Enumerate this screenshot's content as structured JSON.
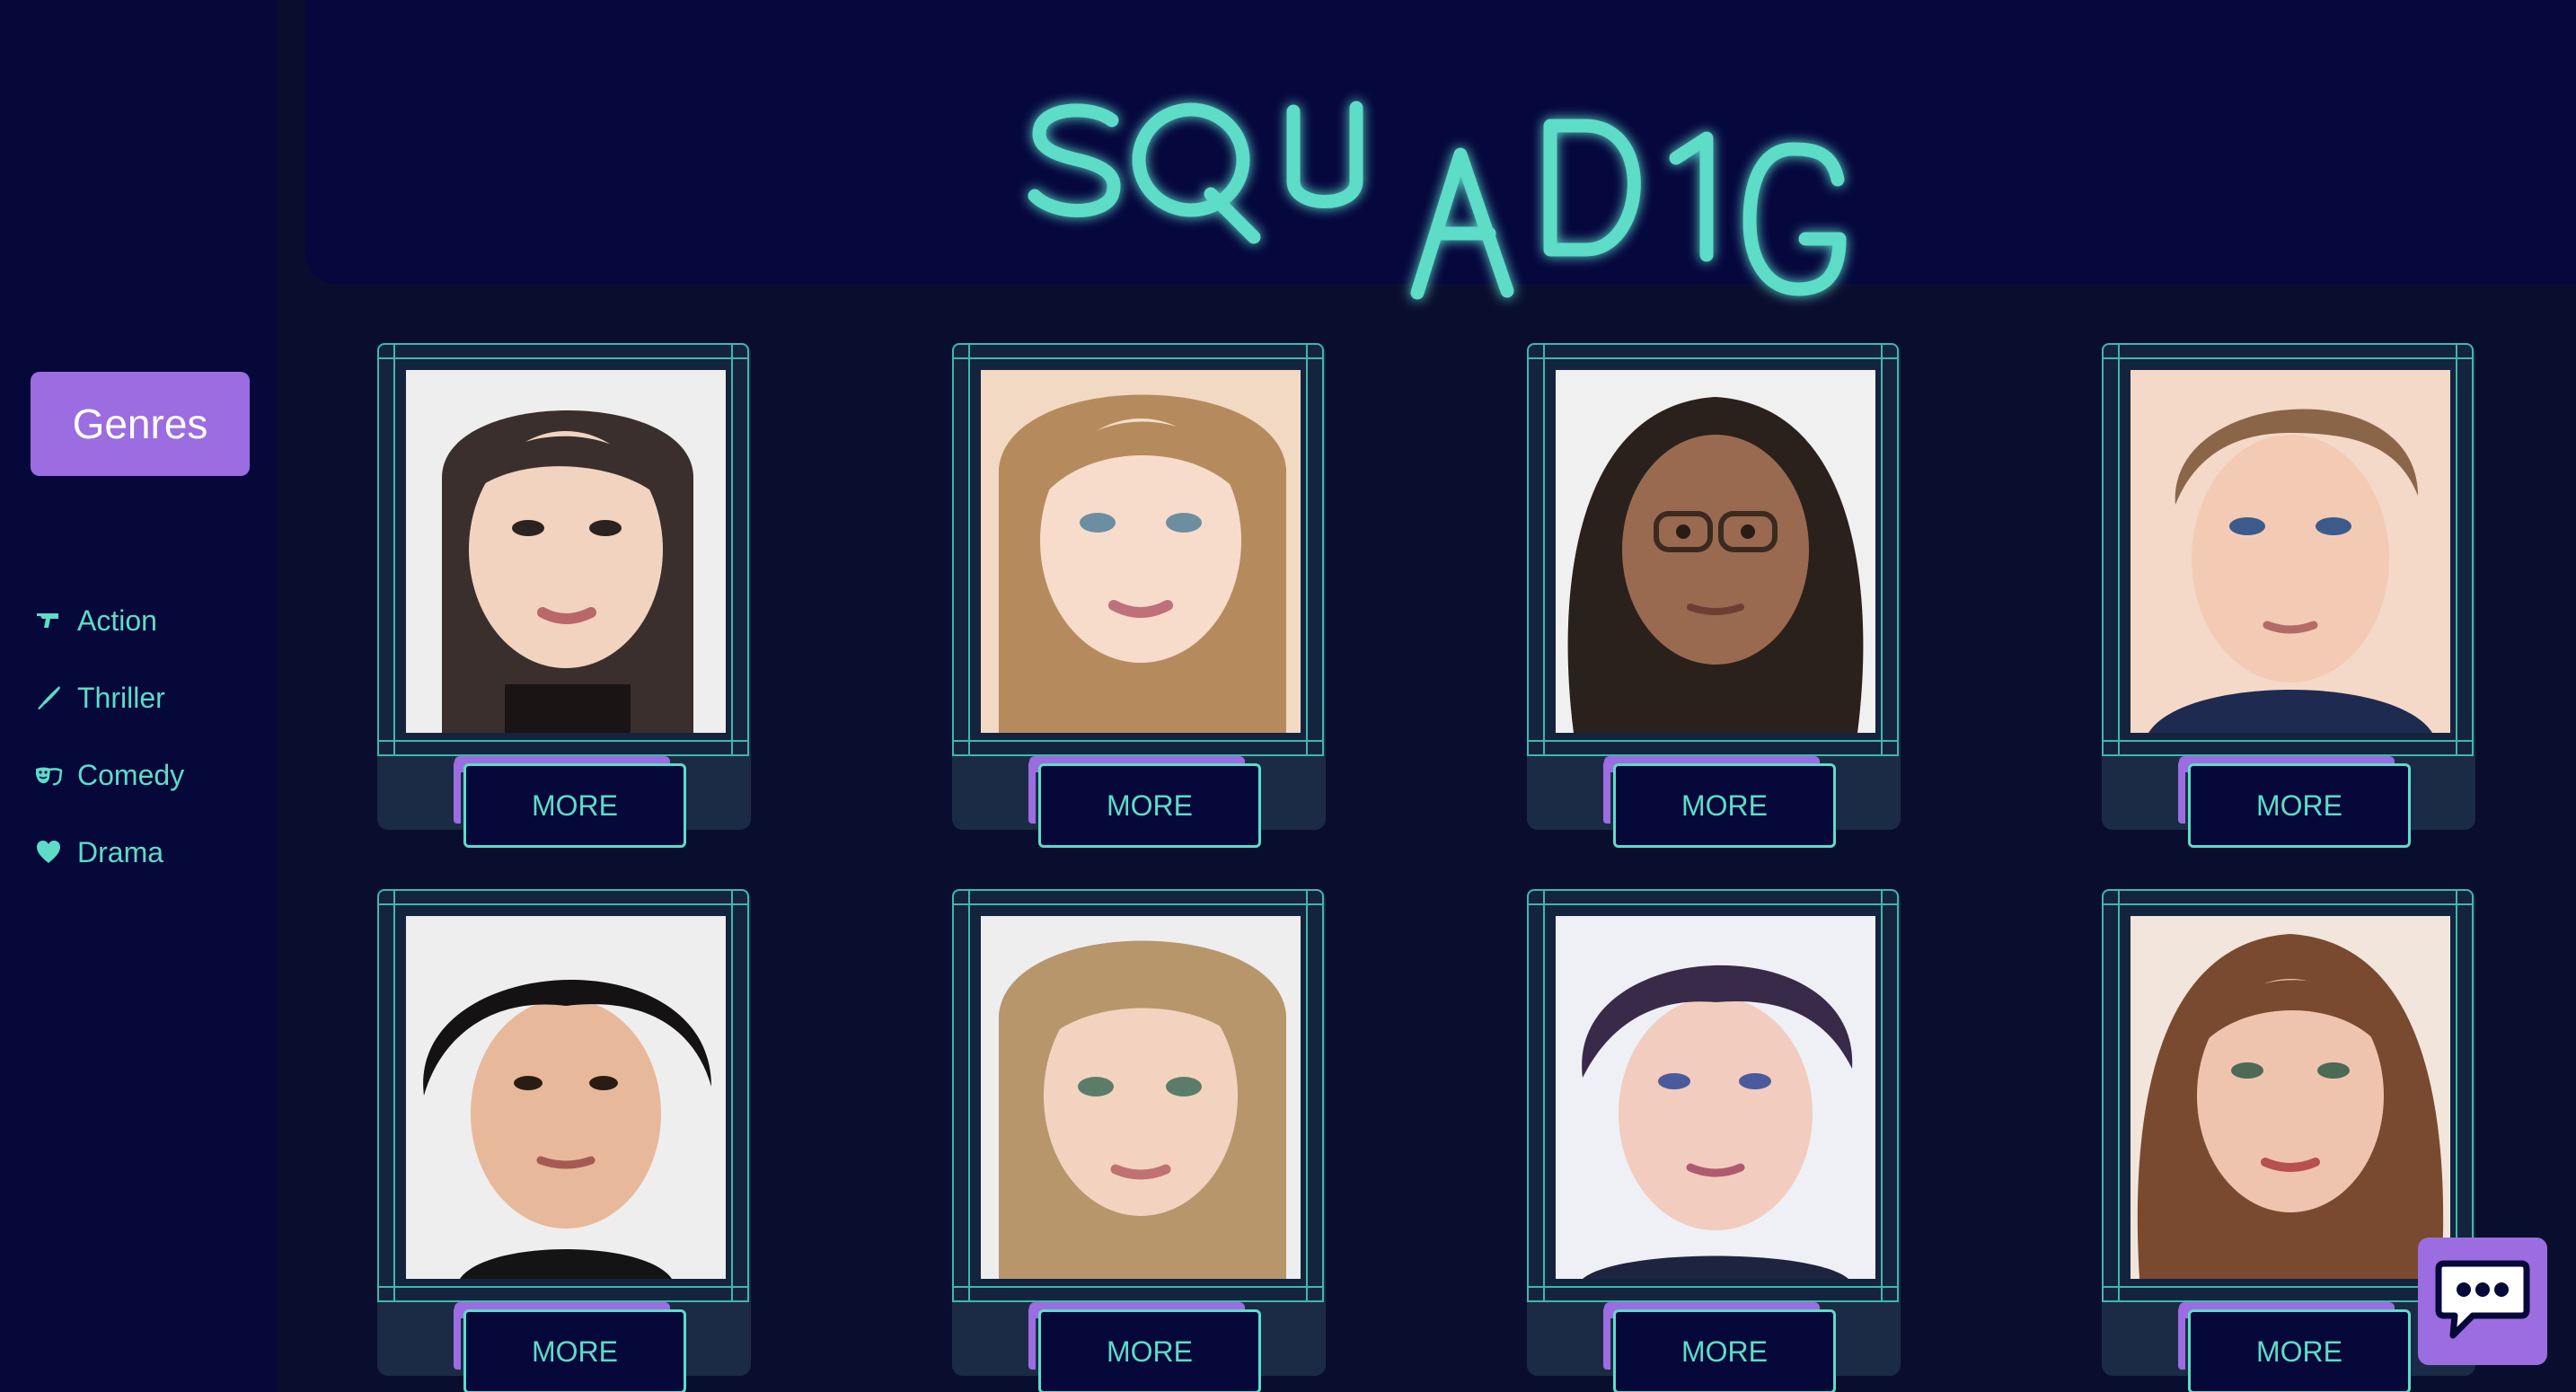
{
  "app": {
    "logo_text": "SQUAD1G"
  },
  "sidebar": {
    "genres_button": "Genres",
    "genres": [
      {
        "label": "Action",
        "icon": "gun-icon"
      },
      {
        "label": "Thriller",
        "icon": "knife-icon"
      },
      {
        "label": "Comedy",
        "icon": "theater-mask-icon"
      },
      {
        "label": "Drama",
        "icon": "heart-icon"
      }
    ]
  },
  "cards": [
    {
      "button": "MORE",
      "portrait": "young-woman-dark-hair-portrait"
    },
    {
      "button": "MORE",
      "portrait": "young-woman-light-brown-hair-portrait"
    },
    {
      "button": "MORE",
      "portrait": "young-person-curly-hair-glasses-portrait"
    },
    {
      "button": "MORE",
      "portrait": "young-man-brown-hair-portrait"
    },
    {
      "button": "MORE",
      "portrait": "young-man-black-curly-hair-portrait"
    },
    {
      "button": "MORE",
      "portrait": "young-woman-blonde-hair-portrait"
    },
    {
      "button": "MORE",
      "portrait": "young-man-dark-curly-hair-portrait"
    },
    {
      "button": "MORE",
      "portrait": "young-woman-auburn-hair-portrait"
    }
  ],
  "chat": {
    "icon": "chat-bubble-icon"
  },
  "colors": {
    "accent_teal": "#5ddcc8",
    "accent_purple": "#9b6de0",
    "background": "#0a0e2e",
    "sidebar": "#06083a"
  }
}
